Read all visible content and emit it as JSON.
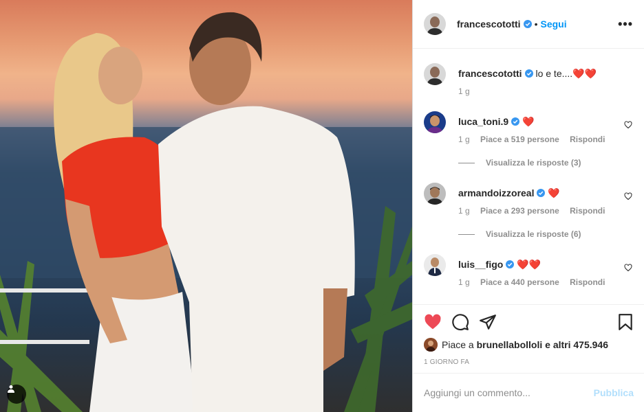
{
  "post": {
    "author": "francescototti",
    "follow_label": "Segui",
    "separator": "•",
    "more_label": "•••",
    "caption": "lo e te....❤️❤️",
    "caption_time": "1 g"
  },
  "comments": [
    {
      "user": "luca_toni.9",
      "text": "❤️",
      "time": "1 g",
      "likes": "Piace a 519 persone",
      "reply": "Rispondi",
      "view_replies": "Visualizza le risposte (3)"
    },
    {
      "user": "armandoizzoreal",
      "text": "❤️",
      "time": "1 g",
      "likes": "Piace a 293 persone",
      "reply": "Rispondi",
      "view_replies": "Visualizza le risposte (6)"
    },
    {
      "user": "luis__figo",
      "text": "❤️❤️",
      "time": "1 g",
      "likes": "Piace a 440 persone",
      "reply": "Rispondi"
    }
  ],
  "likes_summary": {
    "prefix": "Piace a",
    "user": "brunellabolloli",
    "suffix": "e altri 475.946"
  },
  "post_time": "1 GIORNO FA",
  "add_comment": {
    "placeholder": "Aggiungi un commento...",
    "publish_label": "Pubblica"
  },
  "icons": [
    "heart-filled-icon",
    "comment-icon",
    "share-icon",
    "bookmark-icon",
    "verified-icon",
    "user-tag-icon",
    "more-icon"
  ],
  "colors": {
    "like_red": "#ed4956",
    "link_blue": "#0095f6",
    "verified_blue": "#3897f0",
    "publish_disabled": "#b2dffc"
  }
}
